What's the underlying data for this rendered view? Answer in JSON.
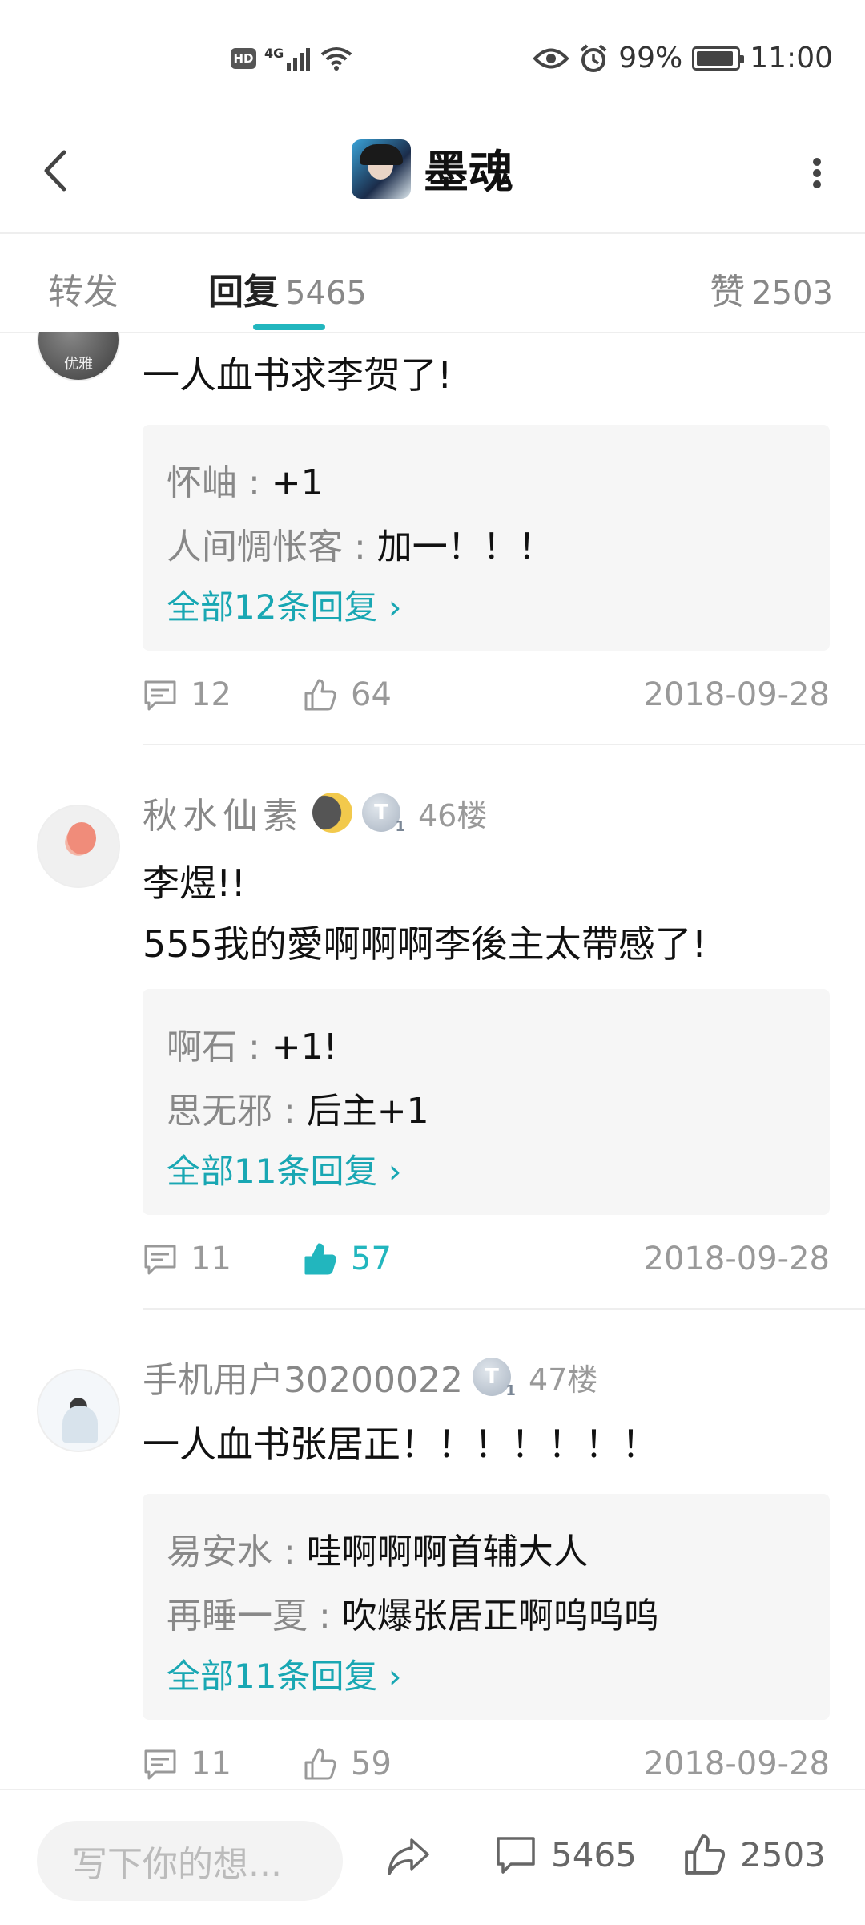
{
  "status_bar": {
    "hd": "HD",
    "network": "4G",
    "battery": "99%",
    "time": "11:00",
    "icons": [
      "signal-icon",
      "wifi-icon",
      "eye-icon",
      "alarm-icon",
      "battery-icon"
    ]
  },
  "header": {
    "title": "墨魂",
    "back_icon": "back-arrow-icon",
    "more_icon": "more-vertical-icon"
  },
  "tabs": {
    "forward": "转发",
    "reply": "回复",
    "reply_count": "5465",
    "like": "赞",
    "like_count": "2503",
    "accent": "#22b6be"
  },
  "comments": [
    {
      "avatar_text": "优雅",
      "text": "一人血书求李贺了!",
      "replies": [
        {
          "user": "怀岫",
          "text": "+1"
        },
        {
          "user": "人间惆怅客",
          "text": "加一！！！"
        }
      ],
      "all_replies": "全部12条回复",
      "comment_count": "12",
      "like_count": "64",
      "date": "2018-09-28"
    },
    {
      "user": "秋水仙素",
      "floor": "46楼",
      "badge": "T",
      "text": "李煜!!\n555我的愛啊啊啊李後主太帶感了!",
      "replies": [
        {
          "user": "啊石",
          "text": "+1!"
        },
        {
          "user": "思无邪",
          "text": "后主+1"
        }
      ],
      "all_replies": "全部11条回复",
      "comment_count": "11",
      "like_count": "57",
      "liked": true,
      "date": "2018-09-28"
    },
    {
      "user": "手机用户30200022",
      "floor": "47楼",
      "badge": "T",
      "text": "一人血书张居正！！！！！！！",
      "replies": [
        {
          "user": "易安水",
          "text": "哇啊啊啊首辅大人"
        },
        {
          "user": "再睡一夏",
          "text": "吹爆张居正啊呜呜呜"
        }
      ],
      "all_replies": "全部11条回复",
      "comment_count": "11",
      "like_count": "59",
      "date": "2018-09-28"
    }
  ],
  "bottom_bar": {
    "placeholder": "写下你的想...",
    "comment_count": "5465",
    "like_count": "2503"
  }
}
